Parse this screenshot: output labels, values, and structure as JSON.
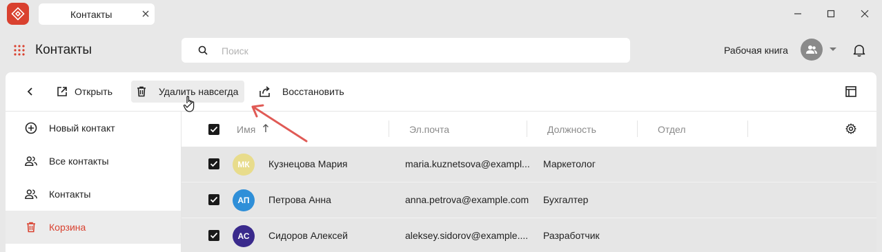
{
  "window": {
    "tab_title": "Контакты"
  },
  "header": {
    "title": "Контакты",
    "search_placeholder": "Поиск",
    "workbook_label": "Рабочая книга"
  },
  "toolbar": {
    "open_label": "Открыть",
    "delete_label": "Удалить навсегда",
    "restore_label": "Восстановить"
  },
  "sidebar": {
    "items": [
      {
        "label": "Новый контакт",
        "icon": "add-circle-icon"
      },
      {
        "label": "Все контакты",
        "icon": "people-icon"
      },
      {
        "label": "Контакты",
        "icon": "people-icon"
      },
      {
        "label": "Корзина",
        "icon": "trash-icon",
        "active": true
      }
    ]
  },
  "table": {
    "columns": [
      "Имя",
      "Эл.почта",
      "Должность",
      "Отдел"
    ],
    "sort": {
      "column": "Имя",
      "direction": "asc"
    },
    "rows": [
      {
        "initials": "МК",
        "avatar_color": "#e8dc8c",
        "name": "Кузнецова Мария",
        "email": "maria.kuznetsova@example.com",
        "email_display": "maria.kuznetsova@exampl...",
        "position": "Маркетолог",
        "department": "",
        "checked": true
      },
      {
        "initials": "АП",
        "avatar_color": "#2f8fd8",
        "name": "Петрова Анна",
        "email": "anna.petrova@example.com",
        "email_display": "anna.petrova@example.com",
        "position": "Бухгалтер",
        "department": "",
        "checked": true
      },
      {
        "initials": "АС",
        "avatar_color": "#3a2a8c",
        "name": "Сидоров Алексей",
        "email": "aleksey.sidorov@example.com",
        "email_display": "aleksey.sidorov@example....",
        "position": "Разработчик",
        "department": "",
        "checked": true
      }
    ]
  },
  "colors": {
    "brand": "#d9412f",
    "active_item": "#d9412f",
    "annotation_arrow": "#e05a55"
  }
}
